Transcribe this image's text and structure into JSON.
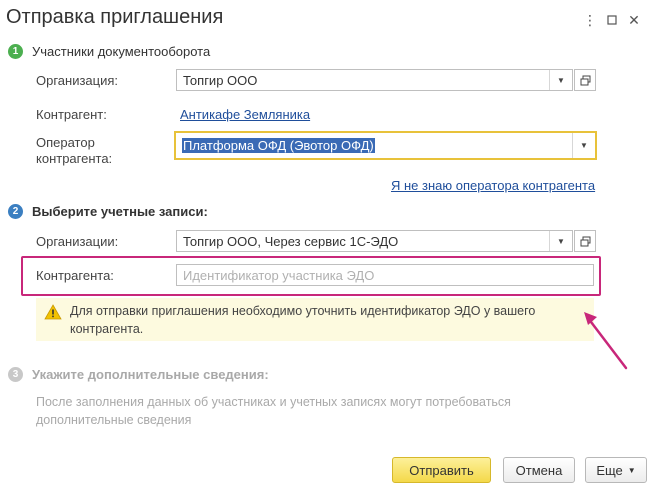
{
  "window": {
    "title": "Отправка приглашения",
    "menu_icon": "more-vertical-icon",
    "maximize_icon": "maximize-icon",
    "close_icon": "close-icon"
  },
  "step1": {
    "number": "1",
    "title": "Участники документооборота",
    "color": "#4caf50",
    "organization_label": "Организация:",
    "organization_value": "Топгир ООО",
    "counterparty_label": "Контрагент:",
    "counterparty_link": "Антикафе Земляника",
    "operator_label_line1": "Оператор",
    "operator_label_line2": "контрагента:",
    "operator_value": "Платформа ОФД (Эвотор ОФД)",
    "unknown_operator_link": "Я не знаю оператора контрагента"
  },
  "step2": {
    "number": "2",
    "title": "Выберите учетные записи:",
    "color": "#3b7fc1",
    "organizations_label": "Организации:",
    "organizations_value": "Топгир ООО, Через сервис 1С-ЭДО",
    "counterparty_label": "Контрагента:",
    "counterparty_placeholder": "Идентификатор участника ЭДО",
    "warning_line1": "Для отправки приглашения необходимо уточнить идентификатор ЭДО у вашего",
    "warning_line2": "контрагента."
  },
  "step3": {
    "number": "3",
    "title": "Укажите дополнительные сведения:",
    "color": "#c8c8c8",
    "hint_line1": "После заполнения данных об участниках и учетных записях могут потребоваться",
    "hint_line2": "дополнительные сведения"
  },
  "buttons": {
    "send": "Отправить",
    "cancel": "Отмена",
    "more": "Еще"
  },
  "colors": {
    "highlight_border": "#c8277a",
    "focus_border": "#e8c23a",
    "link": "#1f4e9b"
  }
}
